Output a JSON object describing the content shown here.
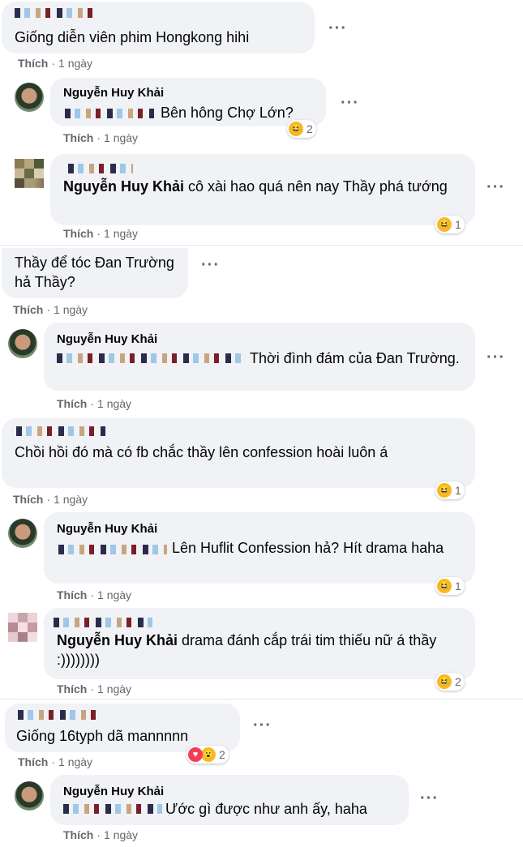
{
  "like_label": "Thích",
  "comments": [
    {
      "name": "",
      "text": "Giống diễn viên phim Hongkong hihi",
      "time": "1 ngày",
      "reaction_count": ""
    },
    {
      "name": "Nguyễn Huy Khải",
      "text": "Bên hông Chợ Lớn?",
      "time": "1 ngày",
      "reaction_count": "2"
    },
    {
      "name": "",
      "tag": "Nguyễn Huy Khải",
      "text": " cô xài hao quá nên nay Thầy phá tướng",
      "time": "1 ngày",
      "reaction_count": "1"
    },
    {
      "name": "",
      "text": "Thầy để tóc Đan Trường hả Thầy?",
      "time": "1 ngày",
      "reaction_count": ""
    },
    {
      "name": "Nguyễn Huy Khải",
      "text": "Thời đình đám của Đan Trường.",
      "time": "1 ngày",
      "reaction_count": ""
    },
    {
      "name": "",
      "text": "Chồi hồi đó mà có fb chắc thầy lên confession hoài luôn á",
      "time": "1 ngày",
      "reaction_count": "1"
    },
    {
      "name": "Nguyễn Huy Khải",
      "text": "Lên Huflit Confession hả? Hít drama haha",
      "time": "1 ngày",
      "reaction_count": "1"
    },
    {
      "name": "",
      "tag": "Nguyễn Huy Khải",
      "text": " drama đánh cắp trái tim thiếu nữ á thầy :))))))))",
      "time": "1 ngày",
      "reaction_count": "2"
    },
    {
      "name": "",
      "text": "Giống 16typh dã mannnnn",
      "time": "1 ngày",
      "reaction_count": "2"
    },
    {
      "name": "Nguyễn Huy Khải",
      "text": "Ước gì được như anh ấy, haha",
      "time": "1 ngày",
      "reaction_count": ""
    }
  ],
  "icons": {
    "more": "more-horizontal-icon",
    "haha": "haha-reaction-icon",
    "love": "love-reaction-icon",
    "wow": "wow-reaction-icon"
  },
  "colors": {
    "bubble": "#f0f2f5",
    "meta": "#65676b",
    "text": "#050505"
  }
}
